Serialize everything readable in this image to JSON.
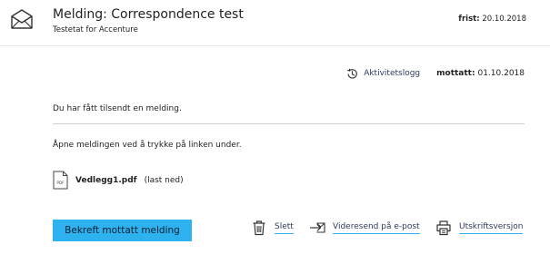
{
  "header": {
    "title": "Melding: Correspondence test",
    "subtitle": "Testetat for Accenture",
    "deadline_label": "frist:",
    "deadline_value": "20.10.2018"
  },
  "meta": {
    "activity_log_label": "Aktivitetslogg",
    "received_label": "mottatt:",
    "received_value": "01.10.2018"
  },
  "body": {
    "message_line": "Du har fått tilsendt en melding.",
    "instruction_line": "Åpne meldingen ved å trykke på linken under."
  },
  "attachment": {
    "filename": "Vedlegg1.pdf",
    "action": "(last ned)",
    "icon": "pdf-file-icon"
  },
  "actions": {
    "confirm_label": "Bekreft mottatt melding",
    "delete_label": "Slett",
    "forward_label": "Videresend på e-post",
    "print_label": "Utskriftsversjon"
  },
  "colors": {
    "accent": "#2db2ef",
    "link": "#2b3a5c"
  }
}
